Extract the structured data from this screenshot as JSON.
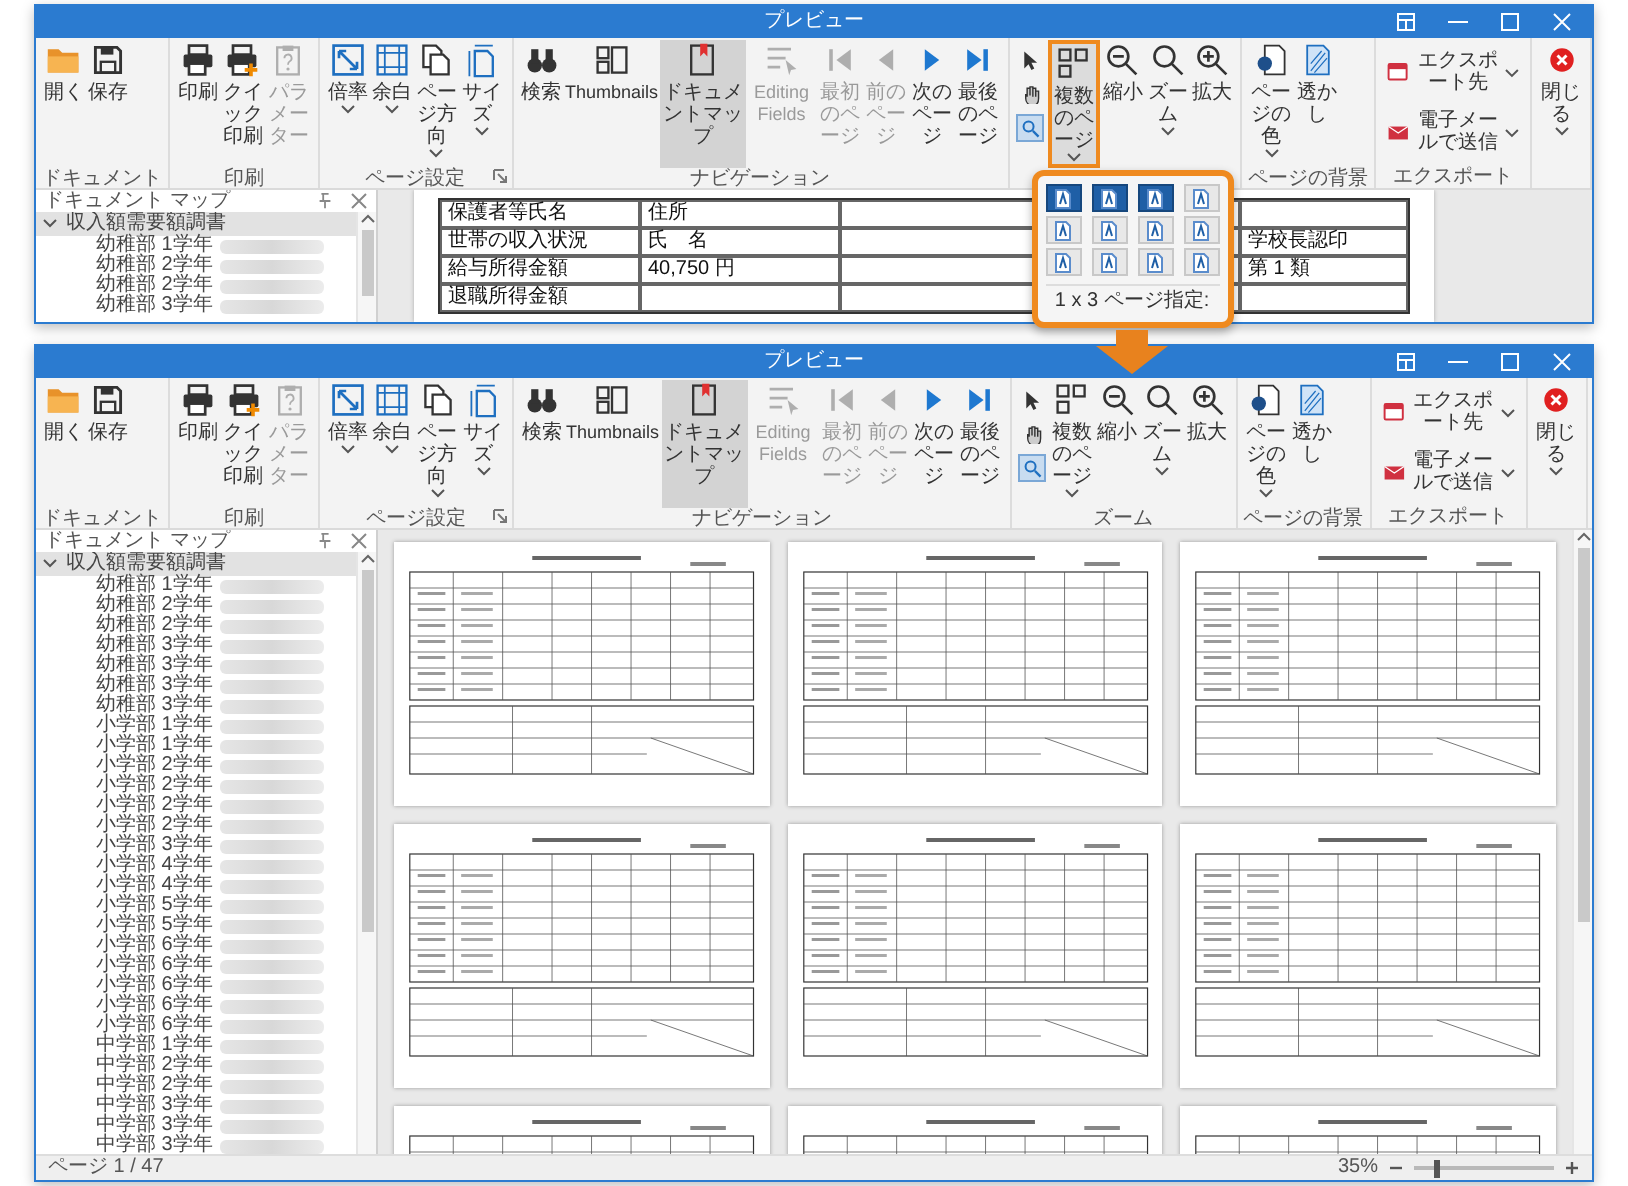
{
  "windows": [
    {
      "title": "プレビュー",
      "ribbon": {
        "groups": [
          {
            "label": "ドキュメント",
            "items": [
              {
                "kind": "large",
                "label": "開く",
                "disabled": false,
                "selected": false,
                "dropdown": false,
                "highlighted": false
              },
              {
                "kind": "large",
                "label": "保存",
                "disabled": false,
                "selected": false,
                "dropdown": false,
                "highlighted": false
              }
            ]
          },
          {
            "label": "印刷",
            "items": [
              {
                "kind": "large",
                "label": "印刷",
                "disabled": false,
                "selected": false,
                "dropdown": false,
                "highlighted": false
              },
              {
                "kind": "large",
                "label": "クイック印刷",
                "disabled": false,
                "selected": false,
                "dropdown": false,
                "highlighted": false
              },
              {
                "kind": "large",
                "label": "パラメーター",
                "disabled": true,
                "selected": false,
                "dropdown": false,
                "highlighted": false
              }
            ]
          },
          {
            "label": "ページ設定",
            "launcher": true,
            "items": [
              {
                "kind": "large",
                "label": "倍率",
                "disabled": false,
                "selected": false,
                "dropdown": true,
                "highlighted": false
              },
              {
                "kind": "large",
                "label": "余白",
                "disabled": false,
                "selected": false,
                "dropdown": true,
                "highlighted": false
              },
              {
                "kind": "large",
                "label": "ページ方向",
                "disabled": false,
                "selected": false,
                "dropdown": true,
                "highlighted": false
              },
              {
                "kind": "large",
                "label": "サイズ",
                "disabled": false,
                "selected": false,
                "dropdown": true,
                "highlighted": false
              }
            ]
          },
          {
            "label": "ナビゲーション",
            "items": [
              {
                "kind": "large",
                "label": "検索",
                "disabled": false,
                "selected": false,
                "dropdown": false,
                "highlighted": false
              },
              {
                "kind": "large",
                "label": "Thumbnails",
                "disabled": false,
                "selected": false,
                "dropdown": false,
                "highlighted": false
              },
              {
                "kind": "large",
                "label": "ドキュメントマップ",
                "disabled": false,
                "selected": true,
                "dropdown": false,
                "highlighted": false
              },
              {
                "kind": "large",
                "label": "Editing Fields",
                "disabled": true,
                "selected": false,
                "dropdown": false,
                "highlighted": false
              },
              {
                "kind": "large",
                "label": "最初のページ",
                "disabled": true,
                "selected": false,
                "dropdown": false,
                "highlighted": false
              },
              {
                "kind": "large",
                "label": "前のページ",
                "disabled": true,
                "selected": false,
                "dropdown": false,
                "highlighted": false
              },
              {
                "kind": "large",
                "label": "次のページ",
                "disabled": false,
                "selected": false,
                "dropdown": false,
                "highlighted": false
              },
              {
                "kind": "large",
                "label": "最後のページ",
                "disabled": false,
                "selected": false,
                "dropdown": false,
                "highlighted": false
              }
            ]
          },
          {
            "tools": [
              {
                "selected": false
              },
              {
                "selected": false
              },
              {
                "selected": true
              }
            ],
            "items": [
              {
                "kind": "large",
                "label": "複数のページ",
                "disabled": false,
                "selected": false,
                "dropdown": true,
                "highlighted": true
              },
              {
                "kind": "large",
                "label": "縮小",
                "disabled": false,
                "selected": false,
                "dropdown": false,
                "highlighted": false
              },
              {
                "kind": "large",
                "label": "ズーム",
                "disabled": false,
                "selected": false,
                "dropdown": true,
                "highlighted": false
              },
              {
                "kind": "large",
                "label": "拡大",
                "disabled": false,
                "selected": false,
                "dropdown": false,
                "highlighted": false
              }
            ]
          },
          {
            "label": "ページの背景",
            "items": [
              {
                "kind": "large",
                "label": "ページの色",
                "disabled": false,
                "selected": false,
                "dropdown": true,
                "highlighted": false
              },
              {
                "kind": "large",
                "label": "透かし",
                "disabled": false,
                "selected": false,
                "dropdown": false,
                "highlighted": false
              }
            ]
          },
          {
            "label": "エクスポート",
            "items": [
              {
                "kind": "small",
                "label": "エクスポート先",
                "disabled": false,
                "selected": false,
                "dropdown": true,
                "highlighted": false
              },
              {
                "kind": "small",
                "label": "電子メールで送信",
                "disabled": false,
                "selected": false,
                "dropdown": true,
                "highlighted": false
              }
            ]
          },
          {
            "items": [
              {
                "kind": "large",
                "label": "閉じる",
                "disabled": false,
                "selected": false,
                "dropdown": true,
                "highlighted": false
              }
            ]
          }
        ]
      },
      "popup": {
        "cells": [
          {
            "selected": true
          },
          {
            "selected": true
          },
          {
            "selected": true
          },
          {
            "selected": false
          },
          {
            "selected": false
          },
          {
            "selected": false
          },
          {
            "selected": false
          },
          {
            "selected": false
          },
          {
            "selected": false
          },
          {
            "selected": false
          },
          {
            "selected": false
          },
          {
            "selected": false
          }
        ],
        "caption": "1 x 3 ページ指定:"
      },
      "document_map": {
        "title": "ドキュメント マップ",
        "tree": [
          {
            "label": "収入額需要額調書",
            "expanded": true,
            "selected": true,
            "children": [
              {
                "label": "幼稚部 1学年",
                "selected": false
              },
              {
                "label": "幼稚部 2学年",
                "selected": false
              },
              {
                "label": "幼稚部 2学年",
                "selected": false
              },
              {
                "label": "幼稚部 3学年",
                "selected": false
              }
            ]
          }
        ]
      },
      "preview": {
        "kind": "page",
        "table_rows": [
          [
            "保護者等氏名",
            "住所"
          ],
          [
            "世帯の収入状況",
            "氏　名",
            "学校長認印"
          ],
          [
            "給与所得金額",
            "40,750 円",
            "第 1 類"
          ],
          [
            "退職所得金額"
          ]
        ]
      }
    },
    {
      "title": "プレビュー",
      "ribbon": {
        "groups": [
          {
            "label": "ドキュメント",
            "items": [
              {
                "kind": "large",
                "label": "開く",
                "disabled": false,
                "selected": false,
                "dropdown": false,
                "highlighted": false
              },
              {
                "kind": "large",
                "label": "保存",
                "disabled": false,
                "selected": false,
                "dropdown": false,
                "highlighted": false
              }
            ]
          },
          {
            "label": "印刷",
            "items": [
              {
                "kind": "large",
                "label": "印刷",
                "disabled": false,
                "selected": false,
                "dropdown": false,
                "highlighted": false
              },
              {
                "kind": "large",
                "label": "クイック印刷",
                "disabled": false,
                "selected": false,
                "dropdown": false,
                "highlighted": false
              },
              {
                "kind": "large",
                "label": "パラメーター",
                "disabled": true,
                "selected": false,
                "dropdown": false,
                "highlighted": false
              }
            ]
          },
          {
            "label": "ページ設定",
            "launcher": true,
            "items": [
              {
                "kind": "large",
                "label": "倍率",
                "disabled": false,
                "selected": false,
                "dropdown": true,
                "highlighted": false
              },
              {
                "kind": "large",
                "label": "余白",
                "disabled": false,
                "selected": false,
                "dropdown": true,
                "highlighted": false
              },
              {
                "kind": "large",
                "label": "ページ方向",
                "disabled": false,
                "selected": false,
                "dropdown": true,
                "highlighted": false
              },
              {
                "kind": "large",
                "label": "サイズ",
                "disabled": false,
                "selected": false,
                "dropdown": true,
                "highlighted": false
              }
            ]
          },
          {
            "label": "ナビゲーション",
            "items": [
              {
                "kind": "large",
                "label": "検索",
                "disabled": false,
                "selected": false,
                "dropdown": false,
                "highlighted": false
              },
              {
                "kind": "large",
                "label": "Thumbnails",
                "disabled": false,
                "selected": false,
                "dropdown": false,
                "highlighted": false
              },
              {
                "kind": "large",
                "label": "ドキュメントマップ",
                "disabled": false,
                "selected": true,
                "dropdown": false,
                "highlighted": false
              },
              {
                "kind": "large",
                "label": "Editing Fields",
                "disabled": true,
                "selected": false,
                "dropdown": false,
                "highlighted": false
              },
              {
                "kind": "large",
                "label": "最初のページ",
                "disabled": true,
                "selected": false,
                "dropdown": false,
                "highlighted": false
              },
              {
                "kind": "large",
                "label": "前のページ",
                "disabled": true,
                "selected": false,
                "dropdown": false,
                "highlighted": false
              },
              {
                "kind": "large",
                "label": "次のページ",
                "disabled": false,
                "selected": false,
                "dropdown": false,
                "highlighted": false
              },
              {
                "kind": "large",
                "label": "最後のページ",
                "disabled": false,
                "selected": false,
                "dropdown": false,
                "highlighted": false
              }
            ]
          },
          {
            "label": "ズーム",
            "tools": [
              {
                "selected": false
              },
              {
                "selected": false
              },
              {
                "selected": true
              }
            ],
            "items": [
              {
                "kind": "large",
                "label": "複数のページ",
                "disabled": false,
                "selected": false,
                "dropdown": true,
                "highlighted": false
              },
              {
                "kind": "large",
                "label": "縮小",
                "disabled": false,
                "selected": false,
                "dropdown": false,
                "highlighted": false
              },
              {
                "kind": "large",
                "label": "ズーム",
                "disabled": false,
                "selected": false,
                "dropdown": true,
                "highlighted": false
              },
              {
                "kind": "large",
                "label": "拡大",
                "disabled": false,
                "selected": false,
                "dropdown": false,
                "highlighted": false
              }
            ]
          },
          {
            "label": "ページの背景",
            "items": [
              {
                "kind": "large",
                "label": "ページの色",
                "disabled": false,
                "selected": false,
                "dropdown": true,
                "highlighted": false
              },
              {
                "kind": "large",
                "label": "透かし",
                "disabled": false,
                "selected": false,
                "dropdown": false,
                "highlighted": false
              }
            ]
          },
          {
            "label": "エクスポート",
            "items": [
              {
                "kind": "small",
                "label": "エクスポート先",
                "disabled": false,
                "selected": false,
                "dropdown": true,
                "highlighted": false
              },
              {
                "kind": "small",
                "label": "電子メールで送信",
                "disabled": false,
                "selected": false,
                "dropdown": true,
                "highlighted": false
              }
            ]
          },
          {
            "items": [
              {
                "kind": "large",
                "label": "閉じる",
                "disabled": false,
                "selected": false,
                "dropdown": true,
                "highlighted": false
              }
            ]
          }
        ]
      },
      "document_map": {
        "title": "ドキュメント マップ",
        "tree": [
          {
            "label": "収入額需要額調書",
            "expanded": true,
            "selected": true,
            "children": [
              {
                "label": "幼稚部 1学年",
                "selected": false
              },
              {
                "label": "幼稚部 2学年",
                "selected": false
              },
              {
                "label": "幼稚部 2学年",
                "selected": false
              },
              {
                "label": "幼稚部 3学年",
                "selected": false
              },
              {
                "label": "幼稚部 3学年",
                "selected": false
              },
              {
                "label": "幼稚部 3学年",
                "selected": false
              },
              {
                "label": "幼稚部 3学年",
                "selected": false
              },
              {
                "label": "小学部 1学年",
                "selected": false
              },
              {
                "label": "小学部 1学年",
                "selected": false
              },
              {
                "label": "小学部 2学年",
                "selected": false
              },
              {
                "label": "小学部 2学年",
                "selected": false
              },
              {
                "label": "小学部 2学年",
                "selected": false
              },
              {
                "label": "小学部 2学年",
                "selected": false
              },
              {
                "label": "小学部 3学年",
                "selected": false
              },
              {
                "label": "小学部 4学年",
                "selected": false
              },
              {
                "label": "小学部 4学年",
                "selected": false
              },
              {
                "label": "小学部 5学年",
                "selected": false
              },
              {
                "label": "小学部 5学年",
                "selected": false
              },
              {
                "label": "小学部 6学年",
                "selected": false
              },
              {
                "label": "小学部 6学年",
                "selected": false
              },
              {
                "label": "小学部 6学年",
                "selected": false
              },
              {
                "label": "小学部 6学年",
                "selected": false
              },
              {
                "label": "小学部 6学年",
                "selected": false
              },
              {
                "label": "中学部 1学年",
                "selected": false
              },
              {
                "label": "中学部 2学年",
                "selected": false
              },
              {
                "label": "中学部 2学年",
                "selected": false
              },
              {
                "label": "中学部 3学年",
                "selected": false
              },
              {
                "label": "中学部 3学年",
                "selected": false
              },
              {
                "label": "中学部 3学年",
                "selected": false
              }
            ]
          }
        ]
      },
      "preview": {
        "kind": "thumbnails"
      },
      "status_bar": {
        "page": "ページ 1 / 47",
        "zoom": "35%",
        "level": 0.15
      }
    }
  ]
}
